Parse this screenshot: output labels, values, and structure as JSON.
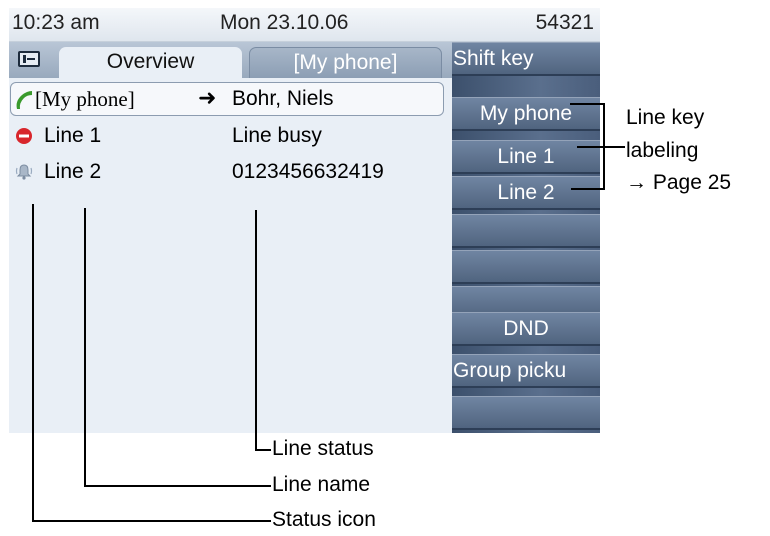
{
  "statusbar": {
    "time": "10:23 am",
    "date": "Mon 23.10.06",
    "extension": "54321"
  },
  "tabs": {
    "menu_icon": "list-menu-icon",
    "overview": "Overview",
    "my_phone": "[My phone]"
  },
  "lines": [
    {
      "icon": "handset-icon",
      "name": "[My phone]",
      "arrow": "➜",
      "status": "Bohr, Niels"
    },
    {
      "icon": "busy-icon",
      "name": "Line 1",
      "status": "Line busy"
    },
    {
      "icon": "ringing-bell-icon",
      "name": "Line 2",
      "status": "0123456632419"
    }
  ],
  "keys": [
    "Shift key",
    "My phone",
    "Line 1",
    "Line 2",
    "",
    "",
    "",
    "DND",
    "Group picku",
    ""
  ],
  "annotations": {
    "line_key_labeling_1": "Line key",
    "line_key_labeling_2": "labeling",
    "line_key_labeling_3": "→ Page 25",
    "line_status": "Line status",
    "line_name": "Line name",
    "status_icon": "Status icon"
  },
  "colors": {
    "screen_bg": "#e9eff6",
    "key_panel": "#50647f",
    "handset": "#3a9a2c",
    "busy": "#d8262c"
  }
}
